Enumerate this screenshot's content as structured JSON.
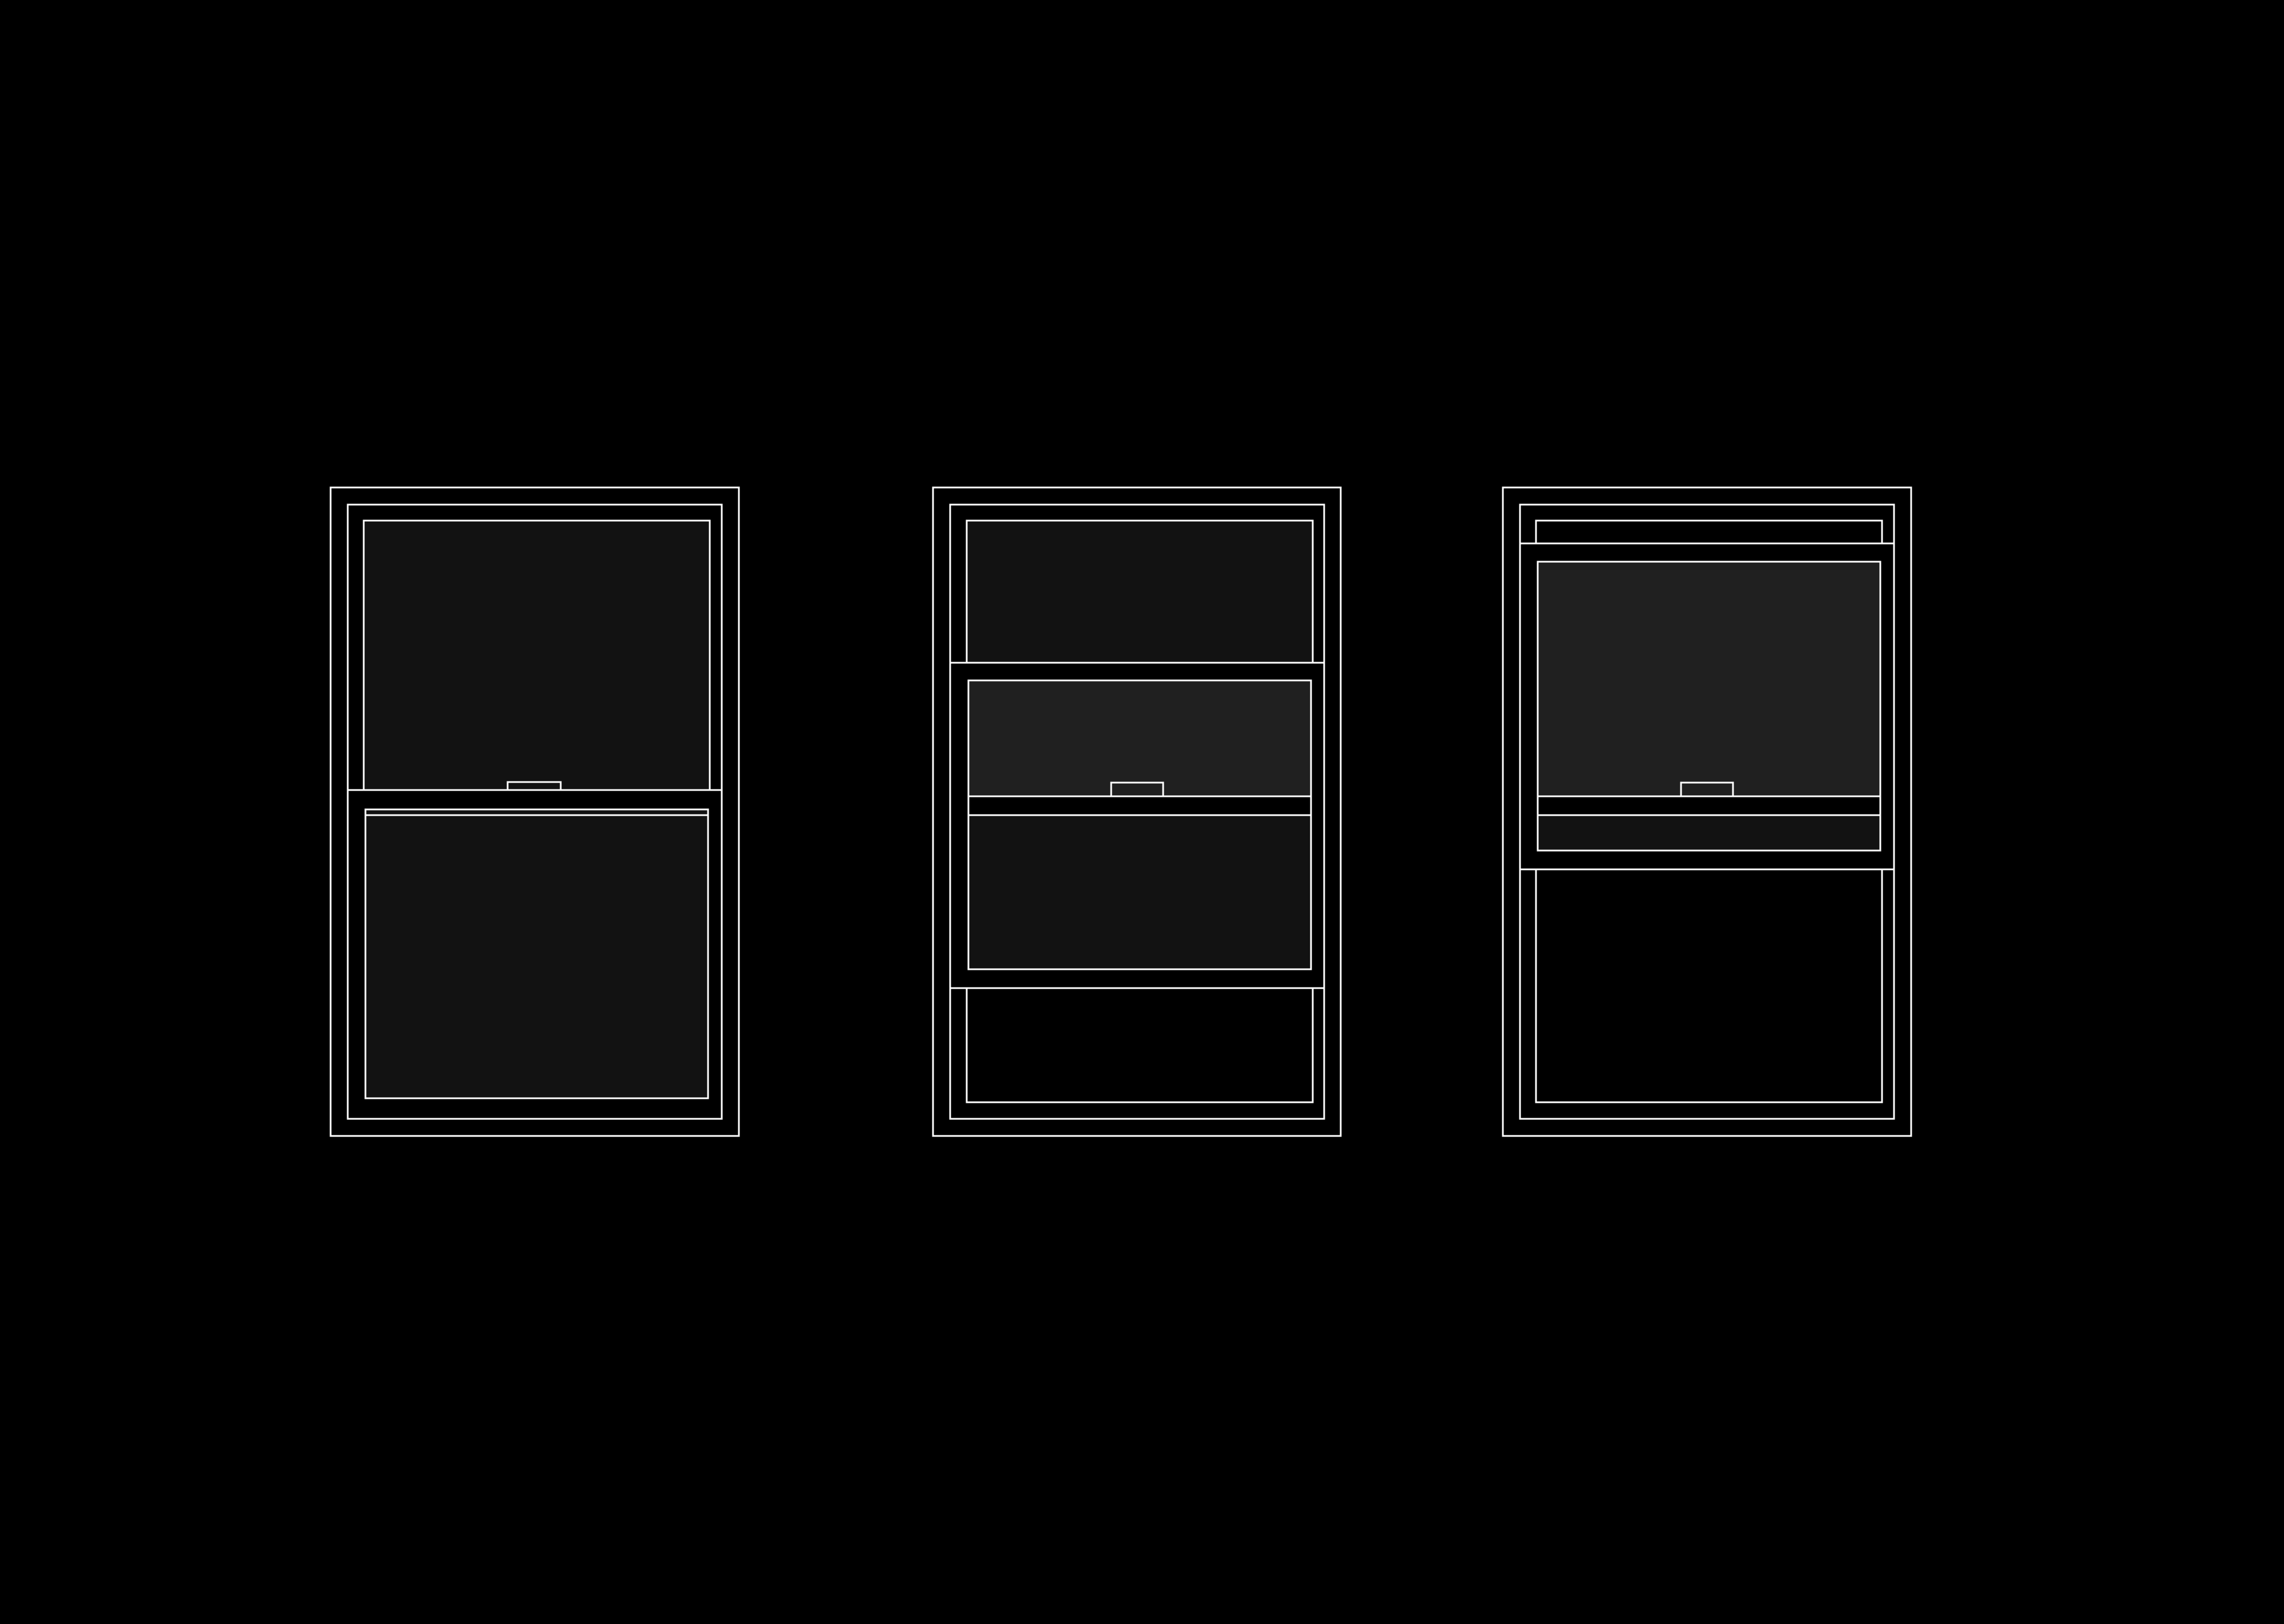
{
  "colors": {
    "background": "#000000",
    "line": "#ffffff",
    "glass_dark": "#121212",
    "glass_light": "#202020"
  },
  "diagram": {
    "windows": [
      {
        "name": "window-closed",
        "lower_sash_offset": 0.0
      },
      {
        "name": "window-half-open",
        "lower_sash_offset": 0.5
      },
      {
        "name": "window-fully-open",
        "lower_sash_offset": 1.0
      }
    ],
    "icons": [
      "double-hung-window-icon",
      "sash-lock-icon"
    ]
  }
}
